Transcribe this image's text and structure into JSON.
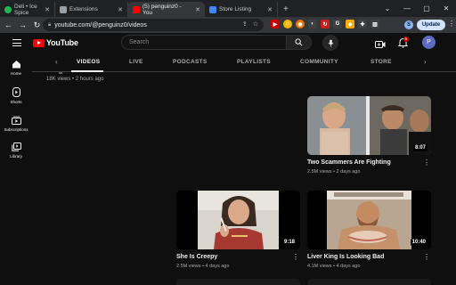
{
  "browser": {
    "tabs": [
      {
        "label": "Deli • Ice Spice",
        "favicon_color": "#1db954"
      },
      {
        "label": "Extensions",
        "favicon_color": "#9aa0a6"
      },
      {
        "label": "(5) penguinz0 - You",
        "favicon_color": "#ff0000"
      },
      {
        "label": "Store Listing",
        "favicon_color": "#4285f4"
      }
    ],
    "new_tab": "+",
    "url": "youtube.com/@penguinz0/videos",
    "update_label": "Update",
    "profile_initial": "S"
  },
  "youtube": {
    "logo_text": "YouTube",
    "search_placeholder": "Search",
    "notification_count": "5",
    "avatar_initial": "P",
    "rail": [
      {
        "label": "Home"
      },
      {
        "label": "Shorts"
      },
      {
        "label": "Subscriptions"
      },
      {
        "label": "Library"
      }
    ],
    "channel_tabs": [
      "VIDEOS",
      "LIVE",
      "PODCASTS",
      "PLAYLISTS",
      "COMMUNITY",
      "STORE"
    ],
    "active_tab": "VIDEOS",
    "prev_video_meta": "18K views • 2 hours ago",
    "videos": [
      {
        "title": "Two Scammers Are Fighting",
        "meta": "2.5M views • 2 days ago",
        "duration": "8:07"
      },
      {
        "title": "She Is Creepy",
        "meta": "2.5M views • 4 days ago",
        "duration": "9:18"
      },
      {
        "title": "Liver King Is Looking Bad",
        "meta": "4.1M views • 4 days ago",
        "duration": "10:40"
      }
    ]
  },
  "colors": {
    "accent": "#ff0000",
    "background": "#0f0f0f"
  }
}
